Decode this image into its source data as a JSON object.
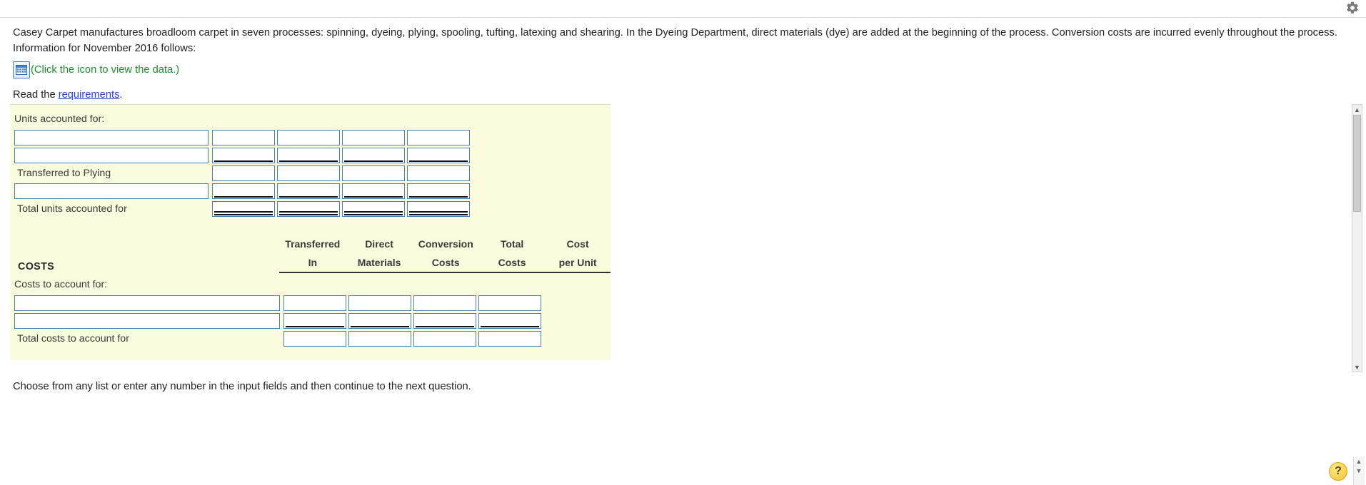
{
  "topbar": {
    "gear_icon": "gear-icon"
  },
  "problem": {
    "paragraph": "Casey Carpet manufactures broadloom carpet in seven processes: spinning, dyeing, plying, spooling, tufting, latexing and shearing. In the Dyeing Department, direct materials (dye) are added at the beginning of the process. Conversion costs are incurred evenly throughout the process. Information for November 2016 follows:",
    "data_icon": "table-grid-icon",
    "data_hint": "(Click the icon to view the data.)",
    "requirements_prefix": "Read the ",
    "requirements_link": "requirements",
    "requirements_suffix": "."
  },
  "worksheet": {
    "units_section_label": "Units accounted for:",
    "units_rows": [
      {
        "label": "",
        "label_is_input": true,
        "label_value": "",
        "rule": "none",
        "cells": [
          "",
          "",
          "",
          ""
        ]
      },
      {
        "label": "",
        "label_is_input": true,
        "label_value": "",
        "rule": "single",
        "cells": [
          "",
          "",
          "",
          ""
        ]
      },
      {
        "label": "Transferred to Plying",
        "label_is_input": false,
        "label_value": "",
        "rule": "none",
        "cells": [
          "",
          "",
          "",
          ""
        ]
      },
      {
        "label": "",
        "label_is_input": true,
        "label_value": "",
        "rule": "single",
        "cells": [
          "",
          "",
          "",
          ""
        ]
      },
      {
        "label": "Total units accounted for",
        "label_is_input": false,
        "label_value": "",
        "rule": "double",
        "cells": [
          "",
          "",
          "",
          ""
        ]
      }
    ],
    "costs_title": "COSTS",
    "costs_headers": [
      {
        "line1": "Transferred",
        "line2": "In"
      },
      {
        "line1": "Direct",
        "line2": "Materials"
      },
      {
        "line1": "Conversion",
        "line2": "Costs"
      },
      {
        "line1": "Total",
        "line2": "Costs"
      },
      {
        "line1": "Cost",
        "line2": "per Unit"
      }
    ],
    "costs_section_label": "Costs to account for:",
    "costs_rows": [
      {
        "label": "",
        "label_is_input": true,
        "label_value": "",
        "rule": "none",
        "cells": [
          "",
          "",
          "",
          ""
        ]
      },
      {
        "label": "",
        "label_is_input": true,
        "label_value": "",
        "rule": "single",
        "cells": [
          "",
          "",
          "",
          ""
        ]
      },
      {
        "label": "Total costs to account for",
        "label_is_input": false,
        "label_value": "",
        "rule": "none",
        "cells": [
          "",
          "",
          "",
          ""
        ]
      }
    ],
    "input_placeholder": ""
  },
  "scrollbar": {
    "up_arrow": "▲",
    "down_arrow": "▼"
  },
  "footer": {
    "note": "Choose from any list or enter any number in the input fields and then continue to the next question.",
    "help_label": "?"
  }
}
